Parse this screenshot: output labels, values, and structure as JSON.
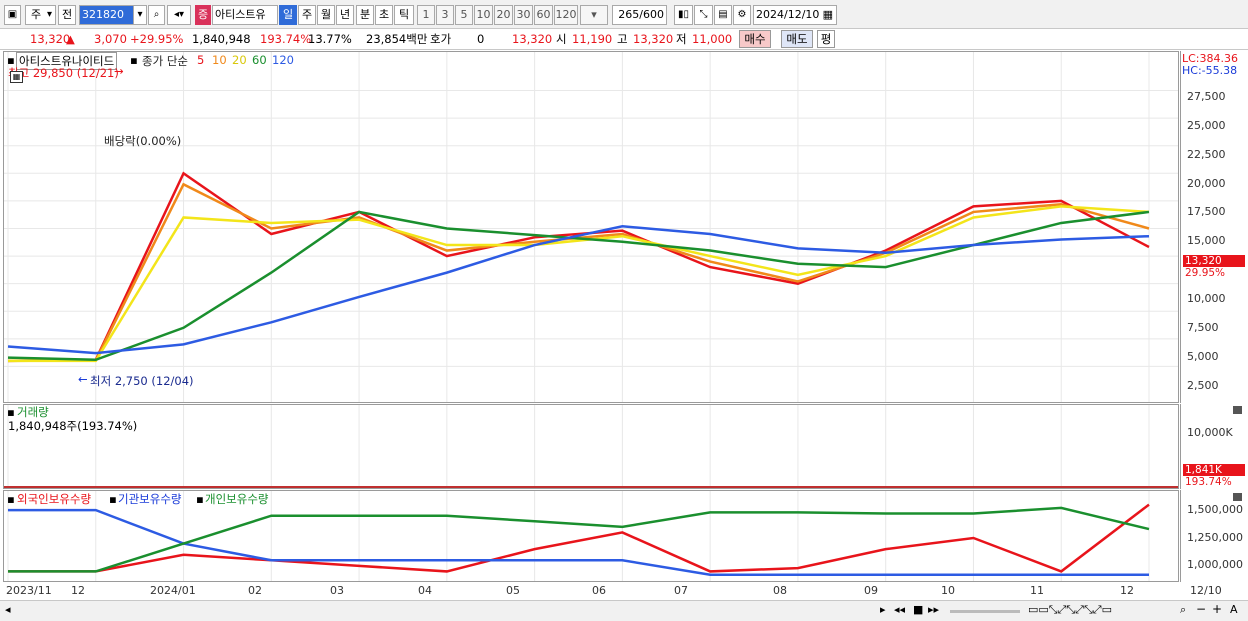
{
  "toolbar": {
    "market_type": "주",
    "prev_label": "전",
    "stock_code": "321820",
    "stock_badge": "증",
    "stock_name": "아티스트유",
    "periods": [
      "일",
      "주",
      "월",
      "년",
      "분",
      "초",
      "틱"
    ],
    "selected_period": "일",
    "intervals": [
      "1",
      "3",
      "5",
      "10",
      "20",
      "30",
      "60",
      "120"
    ],
    "count": "265",
    "count_total": "/600",
    "date": "2024/12/10"
  },
  "quote": {
    "price": "13,320",
    "change": "3,070",
    "change_pct": "+29.95%",
    "volume": "1,840,948",
    "volume_ratio": "193.74%",
    "turnover": "13.77%",
    "amount": "23,854백만",
    "hoga_label": "호가",
    "hoga_value": "0",
    "current": "13,320",
    "open_label": "시",
    "open": "11,190",
    "high_label": "고",
    "high": "13,320",
    "low_label": "저",
    "low": "11,000",
    "buy_label": "매수",
    "sell_label": "매도",
    "avg_label": "평"
  },
  "price_panel": {
    "title": "아티스트유나이티드",
    "ma_label": "종가 단순",
    "ma_periods": [
      "5",
      "10",
      "20",
      "60",
      "120"
    ],
    "ma_colors": [
      "#e8141b",
      "#f0891a",
      "#f3e51a",
      "#1a8f2e",
      "#2d5be3"
    ],
    "high_note": "최고 29,850 (12/21)",
    "low_note": "최저 2,750 (12/04)",
    "dividend_note": "배당락(0.00%)",
    "lc": "LC:384.36",
    "hc": "HC:-55.38",
    "price_tag": "13,320",
    "pct_tag": "29.95%"
  },
  "volume_panel": {
    "title": "거래량",
    "value": "1,840,948주(193.74%)",
    "tag": "1,841K",
    "pct_tag": "193.74%"
  },
  "holding_panel": {
    "series": [
      "외국인보유수량",
      "기관보유수량",
      "개인보유수량"
    ]
  },
  "chart_data": [
    {
      "type": "line",
      "title": "아티스트유나이티드",
      "x": [
        "2023/11",
        "12",
        "2024/01",
        "02",
        "03",
        "04",
        "05",
        "06",
        "07",
        "08",
        "09",
        "10",
        "11",
        "12"
      ],
      "x_tick_labels": [
        "2023/11",
        "12",
        "2024/01",
        "02",
        "03",
        "04",
        "05",
        "06",
        "07",
        "08",
        "09",
        "10",
        "11",
        "12",
        "12/10"
      ],
      "y_ticks": [
        "2,500",
        "5,000",
        "7,500",
        "10,000",
        "12,500",
        "15,000",
        "17,500",
        "20,000",
        "22,500",
        "25,000",
        "27,500"
      ],
      "ylim": [
        0,
        29000
      ],
      "series": [
        {
          "name": "5",
          "values": [
            3000,
            3100,
            20000,
            14500,
            16500,
            12500,
            14200,
            14800,
            11500,
            10000,
            13000,
            17000,
            17500,
            13320
          ]
        },
        {
          "name": "10",
          "values": [
            3000,
            3050,
            19000,
            15000,
            16000,
            13000,
            13800,
            14500,
            12000,
            10200,
            12800,
            16500,
            17200,
            15000
          ]
        },
        {
          "name": "20",
          "values": [
            3000,
            3000,
            16000,
            15500,
            15800,
            13500,
            13500,
            14300,
            12500,
            10800,
            12500,
            16000,
            17000,
            16500
          ]
        },
        {
          "name": "60",
          "values": [
            3300,
            3100,
            6000,
            11000,
            16500,
            15000,
            14400,
            13800,
            13000,
            11800,
            11500,
            13500,
            15500,
            16500
          ]
        },
        {
          "name": "120",
          "values": [
            4300,
            3700,
            4500,
            6500,
            8800,
            11000,
            13500,
            15200,
            14500,
            13200,
            12800,
            13500,
            14000,
            14300
          ]
        }
      ]
    },
    {
      "type": "bar",
      "title": "거래량",
      "y_ticks": [
        "10,000K"
      ],
      "notes": "volume bars; latest 1,841K (193.74%)"
    },
    {
      "type": "line",
      "title": "보유수량",
      "y_ticks": [
        "1,000,000",
        "1,250,000",
        "1,500,000"
      ],
      "ylim": [
        900000,
        1600000
      ],
      "series": [
        {
          "name": "외국인보유수량",
          "values": [
            950000,
            950000,
            1100000,
            1050000,
            1000000,
            950000,
            1150000,
            1300000,
            950000,
            980000,
            1150000,
            1250000,
            950000,
            1550000
          ]
        },
        {
          "name": "기관보유수량",
          "values": [
            1500000,
            1500000,
            1200000,
            1050000,
            1050000,
            1050000,
            1050000,
            1050000,
            920000,
            920000,
            920000,
            920000,
            920000,
            920000
          ]
        },
        {
          "name": "개인보유수량",
          "values": [
            950000,
            950000,
            1200000,
            1450000,
            1450000,
            1450000,
            1400000,
            1350000,
            1480000,
            1480000,
            1470000,
            1470000,
            1520000,
            1330000
          ]
        }
      ]
    }
  ]
}
